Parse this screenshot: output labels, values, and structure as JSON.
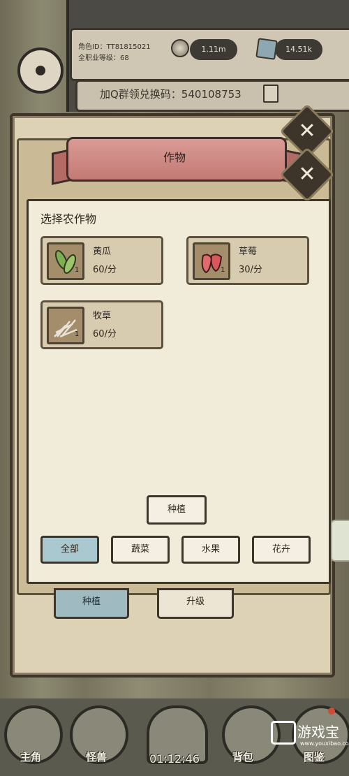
{
  "header": {
    "role_id": "角色ID：TT81815021",
    "job_level": "全职业等级：68",
    "coins": "1.11m",
    "gems": "14.51k",
    "redeem_code": "加Q群领兑换码：540108753"
  },
  "popup": {
    "title": "作物",
    "section_title": "选择农作物",
    "crops": [
      {
        "name": "黄瓜",
        "rate": "60/分",
        "count": "1",
        "icon": "cucumber-icon"
      },
      {
        "name": "草莓",
        "rate": "30/分",
        "count": "1",
        "icon": "strawberry-icon"
      },
      {
        "name": "牧草",
        "rate": "60/分",
        "count": "1",
        "icon": "hay-icon"
      }
    ],
    "plant_button": "种植",
    "filters": [
      "全部",
      "蔬菜",
      "水果",
      "花卉"
    ],
    "active_filter": "全部"
  },
  "tabs": {
    "plant": "种植",
    "upgrade": "升级"
  },
  "bottom_nav": {
    "items": [
      "主角",
      "怪兽",
      "背包",
      "图鉴"
    ],
    "timer": "01:12:46"
  },
  "watermark": {
    "text": "游戏宝",
    "url": "www.youxibao.com"
  },
  "colors": {
    "ribbon": "#c47a74",
    "active_filter": "#a9c8cf",
    "paper": "#f1ebd9"
  }
}
